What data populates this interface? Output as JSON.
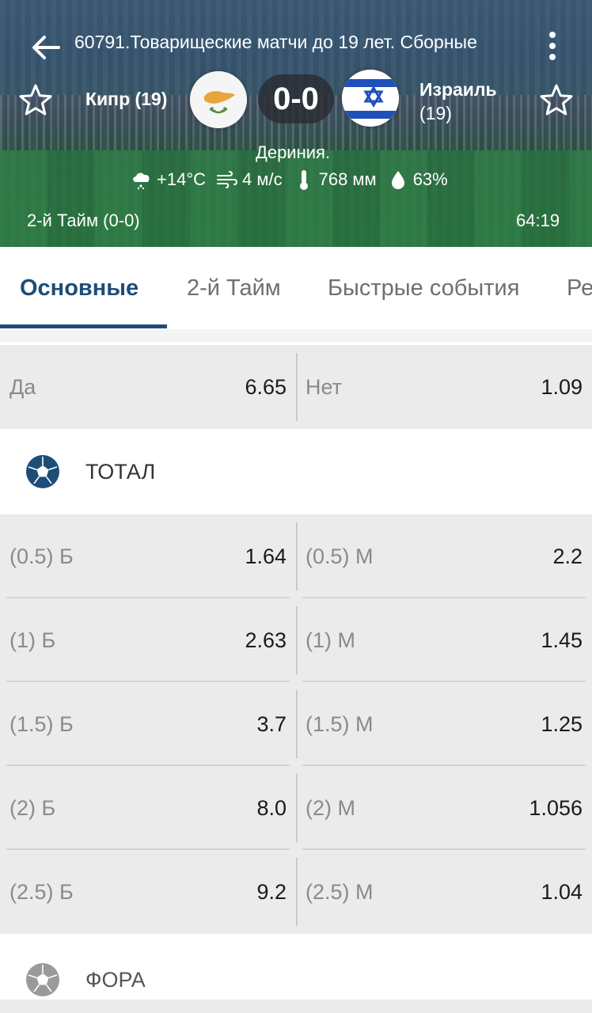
{
  "header": {
    "title": "60791.Товарищеские матчи до 19 лет. Сборные",
    "home_team": "Кипр (19)",
    "away_team_line1": "Израиль",
    "away_team_line2": "(19)",
    "score": "0-0",
    "venue": "Дериния.",
    "weather": {
      "temperature": "+14°C",
      "wind": "4 м/с",
      "pressure": "768 мм",
      "humidity": "63%"
    },
    "period": "2-й  Тайм (0-0)",
    "clock": "64:19"
  },
  "tabs": [
    {
      "label": "Основные",
      "active": true
    },
    {
      "label": "2-й  Тайм",
      "active": false
    },
    {
      "label": "Быстрые события",
      "active": false
    },
    {
      "label": "Ре",
      "active": false
    }
  ],
  "colors": {
    "accent": "#1e4d78",
    "row_bg": "#ebebeb",
    "label_gray": "#8a8a8a"
  },
  "top_row": {
    "left_label": "Да",
    "left_value": "6.65",
    "right_label": "Нет",
    "right_value": "1.09"
  },
  "total_section": {
    "title": "ТОТАЛ",
    "rows": [
      {
        "over_label": "(0.5) Б",
        "over_value": "1.64",
        "under_label": "(0.5) М",
        "under_value": "2.2"
      },
      {
        "over_label": "(1) Б",
        "over_value": "2.63",
        "under_label": "(1) М",
        "under_value": "1.45"
      },
      {
        "over_label": "(1.5) Б",
        "over_value": "3.7",
        "under_label": "(1.5) М",
        "under_value": "1.25"
      },
      {
        "over_label": "(2) Б",
        "over_value": "8.0",
        "under_label": "(2) М",
        "under_value": "1.056"
      },
      {
        "over_label": "(2.5) Б",
        "over_value": "9.2",
        "under_label": "(2.5) М",
        "under_value": "1.04"
      }
    ]
  },
  "fora_section": {
    "title": "ФОРА"
  }
}
